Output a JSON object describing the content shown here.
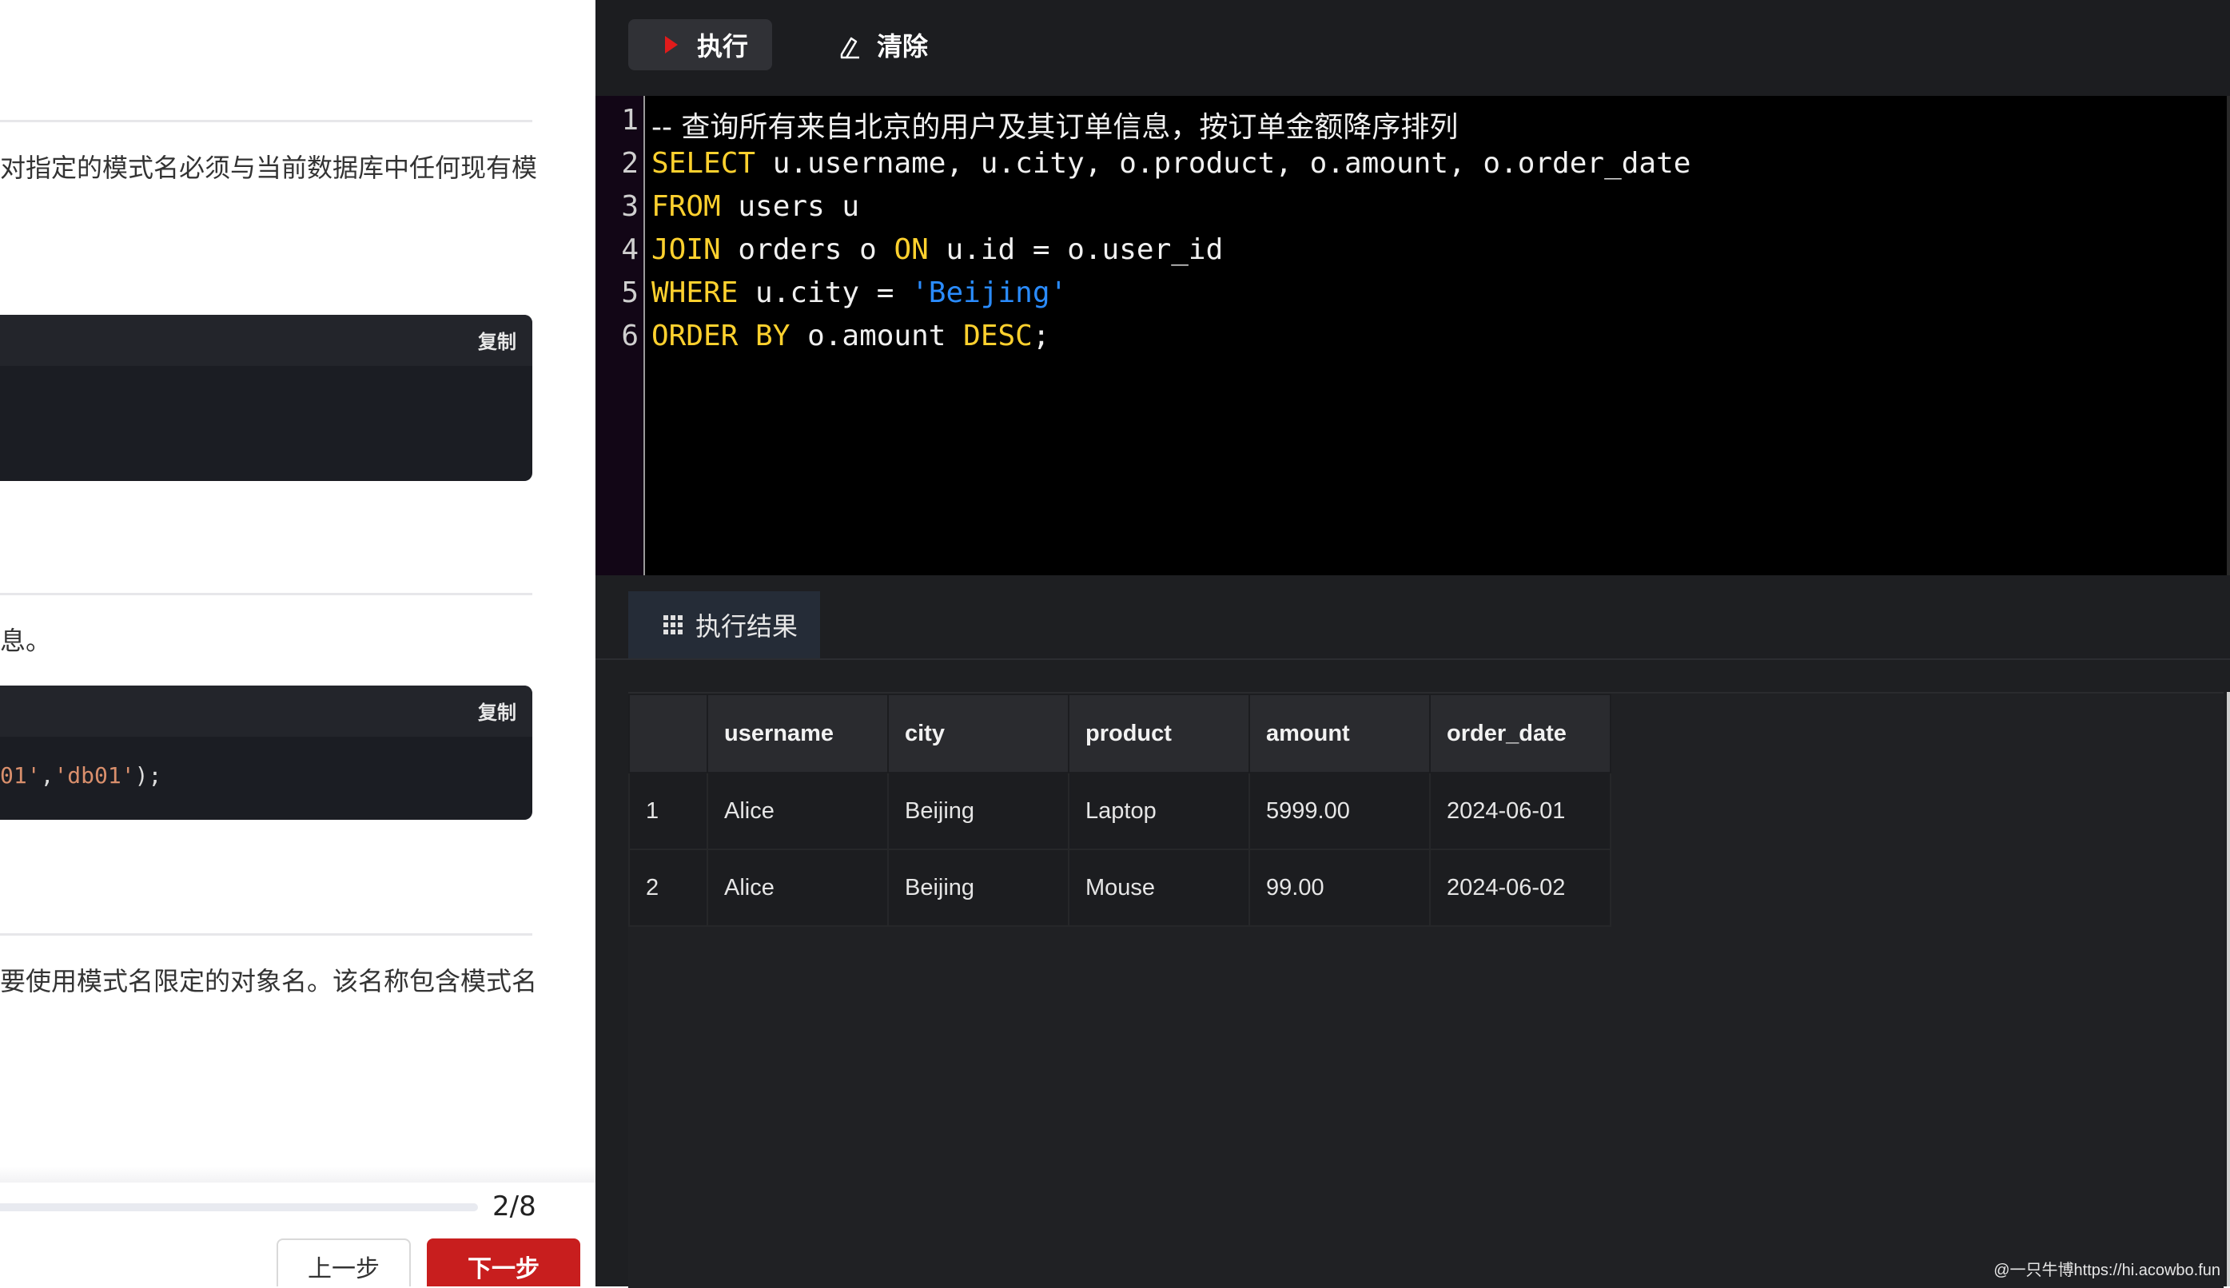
{
  "left_panel": {
    "paragraph1": "对指定的模式名必须与当前数据库中任何现有模",
    "code_block1": {
      "copy_label": "复制"
    },
    "paragraph2": "息。",
    "code_block2": {
      "copy_label": "复制",
      "code_parts": [
        "01'",
        ",",
        "'db01'",
        ");"
      ]
    },
    "paragraph3": "要使用模式名限定的对象名。该名称包含模式名",
    "progress": {
      "label": "2/8",
      "current": 2,
      "total": 8
    },
    "prev_label": "上一步",
    "next_label": "下一步"
  },
  "toolbar": {
    "run_label": "执行",
    "clear_label": "清除"
  },
  "editor": {
    "line_numbers": [
      "1",
      "2",
      "3",
      "4",
      "5",
      "6"
    ],
    "lines": [
      [
        {
          "t": "-- 查询所有来自北京的用户及其订单信息，按订单金额降序排列",
          "c": "cmt"
        }
      ],
      [
        {
          "t": "SELECT",
          "c": "kw"
        },
        {
          "t": " u.username, u.city, o.product, o.amount, o.order_date",
          "c": ""
        }
      ],
      [
        {
          "t": "FROM",
          "c": "kw"
        },
        {
          "t": " users u",
          "c": ""
        }
      ],
      [
        {
          "t": "JOIN",
          "c": "kw"
        },
        {
          "t": " orders o ",
          "c": ""
        },
        {
          "t": "ON",
          "c": "kw"
        },
        {
          "t": " u.id = o.user_id",
          "c": ""
        }
      ],
      [
        {
          "t": "WHERE",
          "c": "kw"
        },
        {
          "t": " u.city = ",
          "c": ""
        },
        {
          "t": "'Beijing'",
          "c": "sqlstr"
        }
      ],
      [
        {
          "t": "ORDER BY",
          "c": "kw"
        },
        {
          "t": " o.amount ",
          "c": ""
        },
        {
          "t": "DESC",
          "c": "kw"
        },
        {
          "t": ";",
          "c": ""
        }
      ]
    ]
  },
  "results": {
    "tab_label": "执行结果",
    "columns": [
      "",
      "username",
      "city",
      "product",
      "amount",
      "order_date"
    ],
    "rows": [
      [
        "1",
        "Alice",
        "Beijing",
        "Laptop",
        "5999.00",
        "2024-06-01"
      ],
      [
        "2",
        "Alice",
        "Beijing",
        "Mouse",
        "99.00",
        "2024-06-02"
      ]
    ]
  },
  "watermark": "@一只牛博https://hi.acowbo.fun",
  "colors": {
    "keyword": "#ffd12e",
    "string": "#2a8cff",
    "run_icon": "#e01b1b",
    "next_button": "#c81e1e"
  }
}
